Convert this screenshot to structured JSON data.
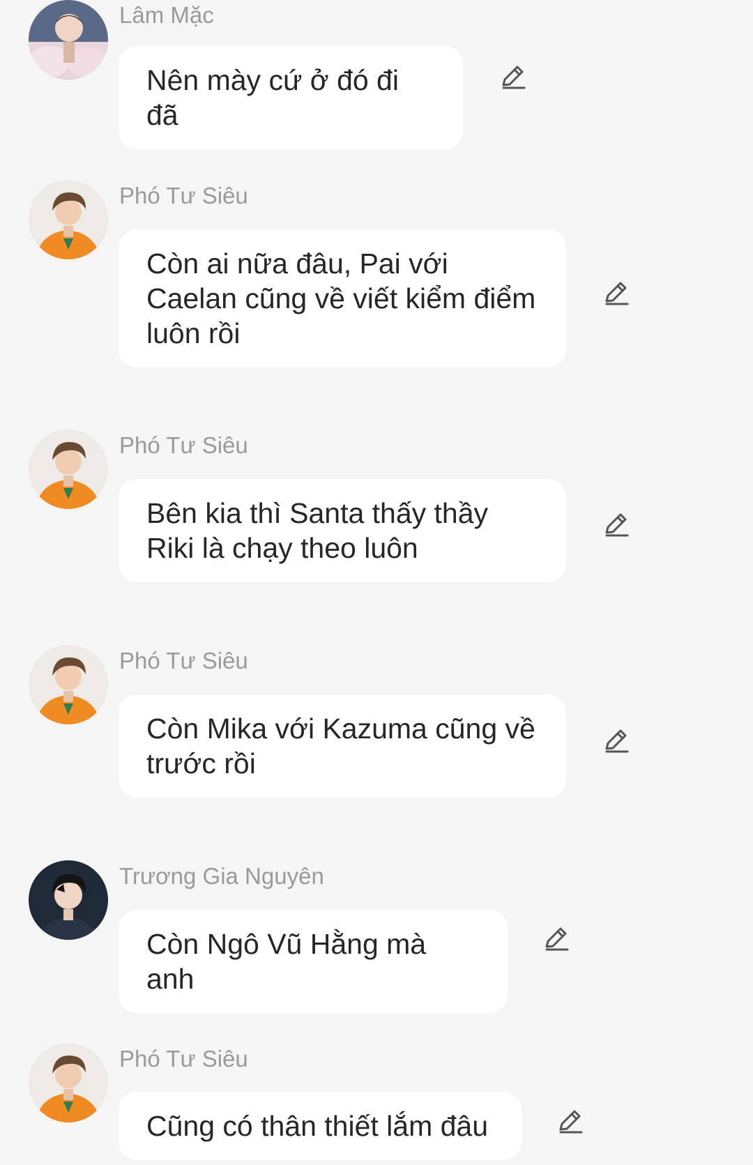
{
  "messages": [
    {
      "sender": "Lâm Mặc",
      "text": "Nên mày cứ ở đó đi đã",
      "avatar": "avatar-lam-mac"
    },
    {
      "sender": "Phó Tư Siêu",
      "text": "Còn ai nữa đâu, Pai với Caelan cũng về viết kiểm điểm luôn rồi",
      "avatar": "avatar-pho-tu-sieu"
    },
    {
      "sender": "Phó Tư Siêu",
      "text": "Bên kia thì Santa thấy thầy Riki là chạy theo luôn",
      "avatar": "avatar-pho-tu-sieu"
    },
    {
      "sender": "Phó Tư Siêu",
      "text": "Còn Mika với Kazuma cũng về trước rồi",
      "avatar": "avatar-pho-tu-sieu"
    },
    {
      "sender": "Trương Gia Nguyên",
      "text": "Còn Ngô Vũ Hằng mà anh",
      "avatar": "avatar-truong-gia-nguyen"
    },
    {
      "sender": "Phó Tư Siêu",
      "text": "Cũng có thân thiết lắm đâu",
      "avatar": "avatar-pho-tu-sieu"
    }
  ],
  "icons": {
    "edit": "pencil-edit-icon"
  },
  "colors": {
    "background": "#f5f5f5",
    "bubble": "#ffffff",
    "sender_name": "#9a9a9a",
    "message_text": "#262626",
    "icon": "#555555"
  }
}
